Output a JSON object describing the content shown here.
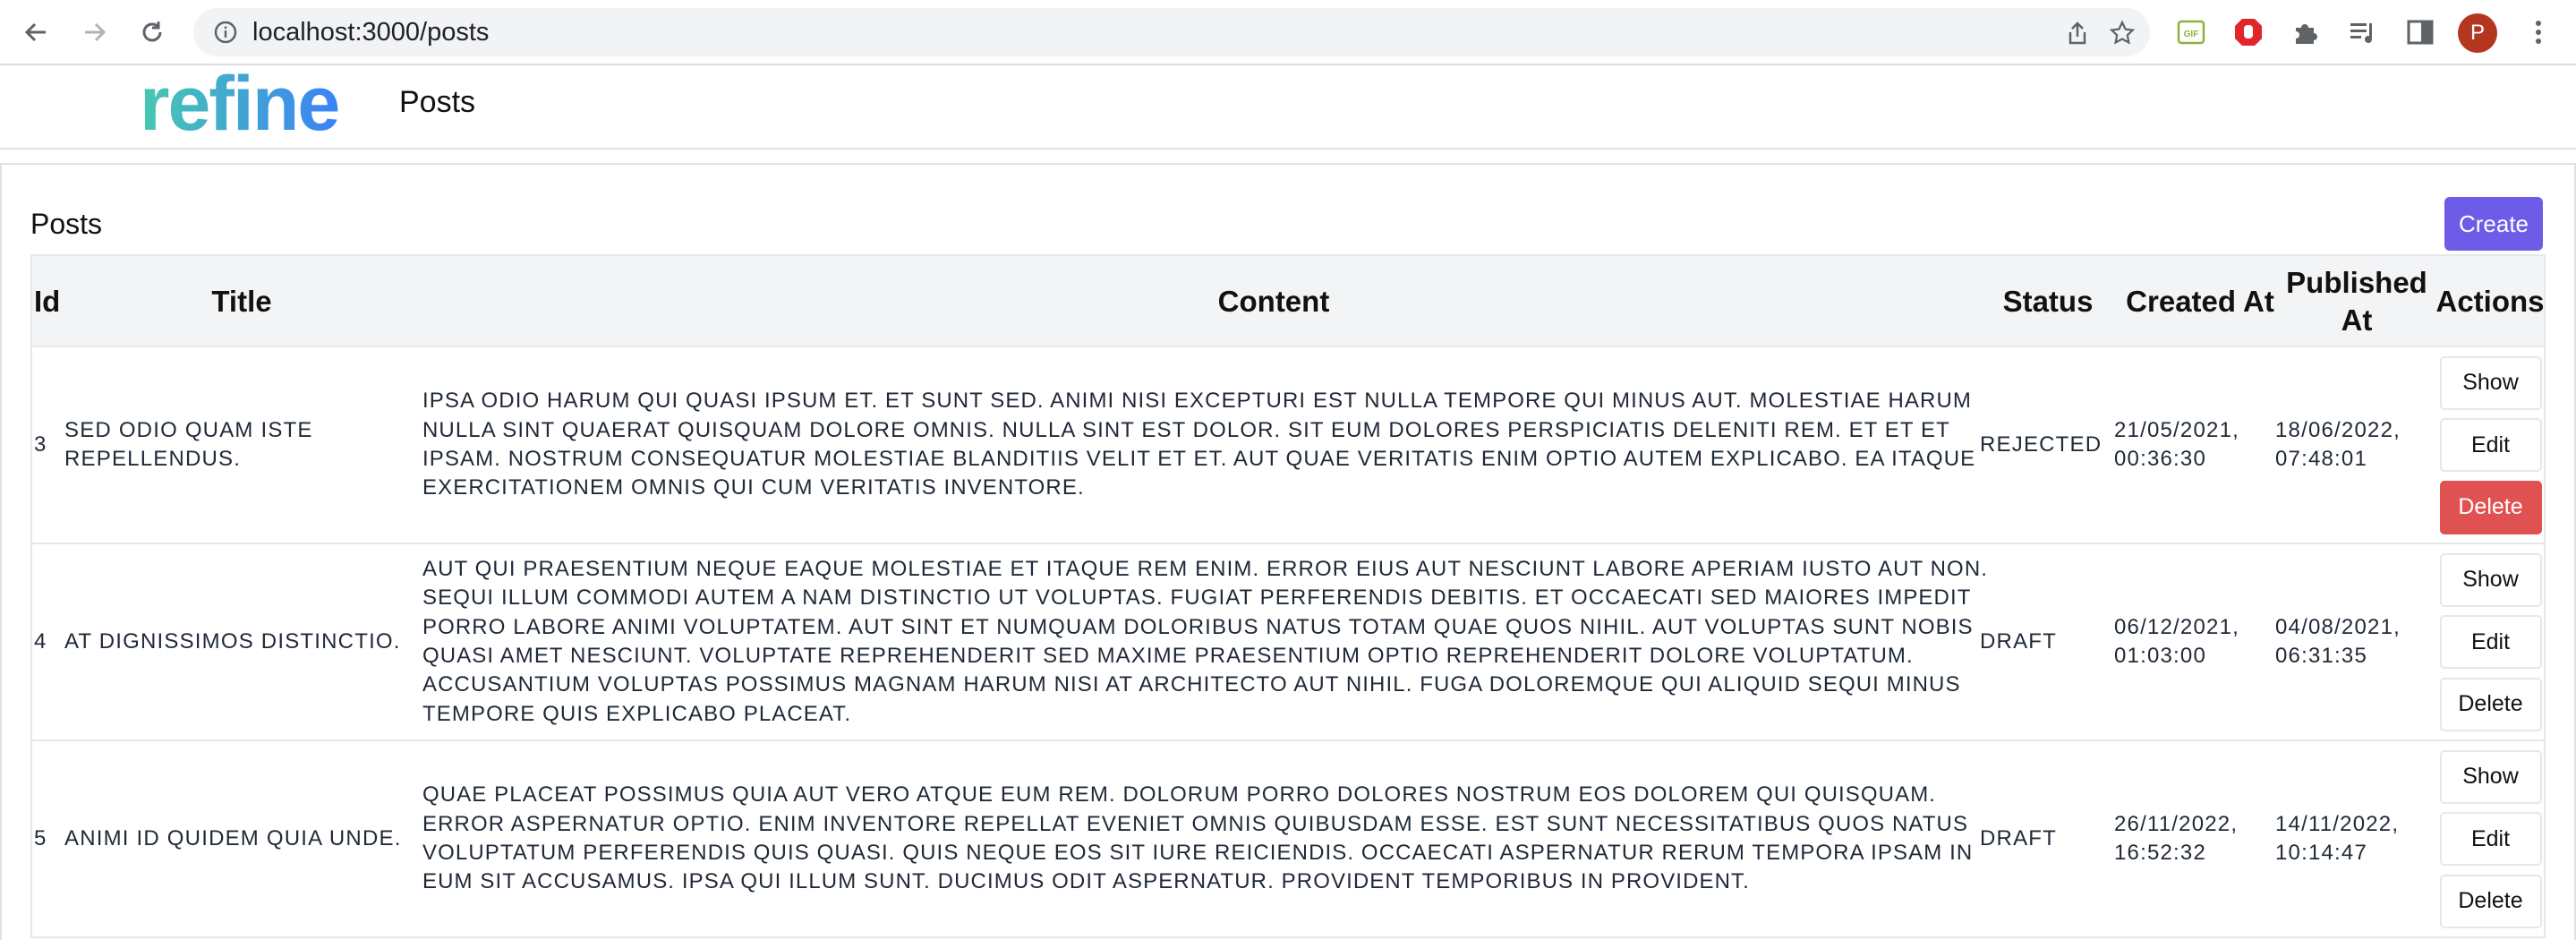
{
  "browser": {
    "url": "localhost:3000/posts",
    "profile_initial": "P",
    "icons": [
      "back-arrow-icon",
      "forward-arrow-icon",
      "reload-icon",
      "info-icon",
      "share-icon",
      "star-icon",
      "gif-extension-icon",
      "adblock-extension-icon",
      "puzzle-extension-icon",
      "media-control-icon",
      "side-panel-icon",
      "kebab-menu-icon"
    ]
  },
  "header": {
    "brand": "refine",
    "title": "Posts"
  },
  "page": {
    "title": "Posts",
    "create_label": "Create"
  },
  "table": {
    "columns": [
      "Id",
      "Title",
      "Content",
      "Status",
      "Created At",
      "Published At",
      "Actions"
    ],
    "rows": [
      {
        "id": "3",
        "title": "SED ODIO QUAM ISTE REPELLENDUS.",
        "content": "IPSA ODIO HARUM QUI QUASI IPSUM ET. ET SUNT SED. ANIMI NISI EXCEPTURI EST NULLA TEMPORE QUI MINUS AUT. MOLESTIAE HARUM NULLA SINT QUAERAT QUISQUAM DOLORE OMNIS. NULLA SINT EST DOLOR. SIT EUM DOLORES PERSPICIATIS DELENITI REM. ET ET ET IPSAM. NOSTRUM CONSEQUATUR MOLESTIAE BLANDITIIS VELIT ET ET. AUT QUAE VERITATIS ENIM OPTIO AUTEM EXPLICABO. EA ITAQUE EXERCITATIONEM OMNIS QUI CUM VERITATIS INVENTORE.",
        "status": "REJECTED",
        "created_at": "21/05/2021, 00:36:30",
        "published_at": "18/06/2022, 07:48:01",
        "actions": {
          "show": "Show",
          "edit": "Edit",
          "delete": "Delete"
        }
      },
      {
        "id": "4",
        "title": "AT DIGNISSIMOS DISTINCTIO.",
        "content": "AUT QUI PRAESENTIUM NEQUE EAQUE MOLESTIAE ET ITAQUE REM ENIM. ERROR EIUS AUT NESCIUNT LABORE APERIAM IUSTO AUT NON. SEQUI ILLUM COMMODI AUTEM A NAM DISTINCTIO UT VOLUPTAS. FUGIAT PERFERENDIS DEBITIS. ET OCCAECATI SED MAIORES IMPEDIT PORRO LABORE ANIMI VOLUPTATEM. AUT SINT ET NUMQUAM DOLORIBUS NATUS TOTAM QUAE QUOS NIHIL. AUT VOLUPTAS SUNT NOBIS QUASI AMET NESCIUNT. VOLUPTATE REPREHENDERIT SED MAXIME PRAESENTIUM OPTIO REPREHENDERIT DOLORE VOLUPTATUM. ACCUSANTIUM VOLUPTAS POSSIMUS MAGNAM HARUM NISI AT ARCHITECTO AUT NIHIL. FUGA DOLOREMQUE QUI ALIQUID SEQUI MINUS TEMPORE QUIS EXPLICABO PLACEAT.",
        "status": "DRAFT",
        "created_at": "06/12/2021, 01:03:00",
        "published_at": "04/08/2021, 06:31:35",
        "actions": {
          "show": "Show",
          "edit": "Edit",
          "delete": "Delete"
        }
      },
      {
        "id": "5",
        "title": "ANIMI ID QUIDEM QUIA UNDE.",
        "content": "QUAE PLACEAT POSSIMUS QUIA AUT VERO ATQUE EUM REM. DOLORUM PORRO DOLORES NOSTRUM EOS DOLOREM QUI QUISQUAM. ERROR ASPERNATUR OPTIO. ENIM INVENTORE REPELLAT EVENIET OMNIS QUIBUSDAM ESSE. EST SUNT NECESSITATIBUS QUOS NATUS VOLUPTATUM PERFERENDIS QUIS QUASI. QUIS NEQUE EOS SIT IURE REICIENDIS. OCCAECATI ASPERNATUR RERUM TEMPORA IPSAM IN EUM SIT ACCUSAMUS. IPSA QUI ILLUM SUNT. DUCIMUS ODIT ASPERNATUR. PROVIDENT TEMPORIBUS IN PROVIDENT.",
        "status": "DRAFT",
        "created_at": "26/11/2022, 16:52:32",
        "published_at": "14/11/2022, 10:14:47",
        "actions": {
          "show": "Show",
          "edit": "Edit",
          "delete": "Delete"
        }
      }
    ]
  },
  "colors": {
    "accent": "#6c5ce7",
    "danger": "#e05252",
    "logo_teal": "#47c9b0",
    "logo_blue": "#3b82f6",
    "header_bg": "#f3f4f6"
  }
}
